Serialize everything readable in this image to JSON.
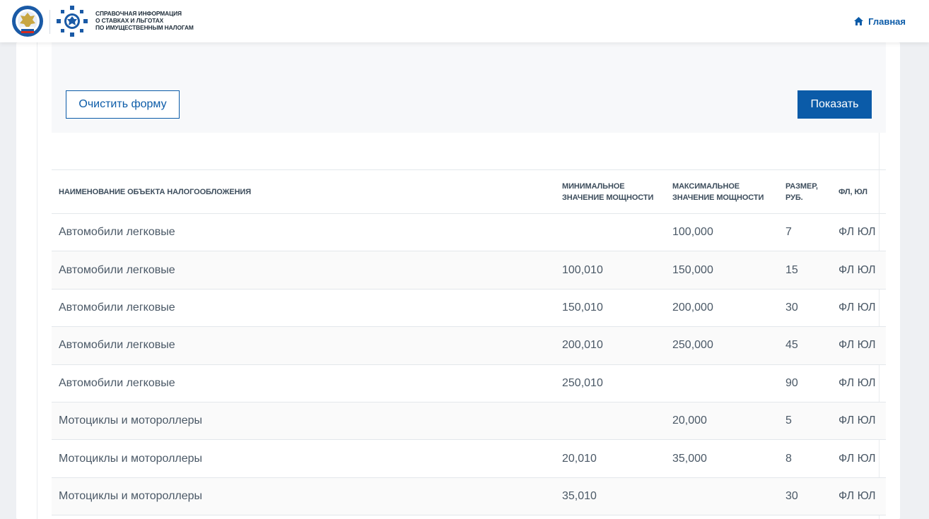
{
  "header": {
    "logo_lines": [
      "Справочная информация",
      "о ставках и льготах",
      "по имущественным налогам"
    ],
    "nav_home_label": "Главная"
  },
  "filter": {
    "clear_label": "Очистить форму",
    "show_label": "Показать"
  },
  "table": {
    "headers": {
      "object_name": "Наименование объекта налогообложения",
      "min_power_line1": "Минимальное",
      "min_power_line2": "значение мощности",
      "max_power_line1": "Максимальное",
      "max_power_line2": "значение мощности",
      "rate_line1": "Размер,",
      "rate_line2": "руб.",
      "payer": "ФЛ, ЮЛ"
    },
    "rows": [
      {
        "name": "Автомобили легковые",
        "min": "",
        "max": "100,000",
        "rate": "7",
        "payer": "ФЛ ЮЛ"
      },
      {
        "name": "Автомобили легковые",
        "min": "100,010",
        "max": "150,000",
        "rate": "15",
        "payer": "ФЛ ЮЛ"
      },
      {
        "name": "Автомобили легковые",
        "min": "150,010",
        "max": "200,000",
        "rate": "30",
        "payer": "ФЛ ЮЛ"
      },
      {
        "name": "Автомобили легковые",
        "min": "200,010",
        "max": "250,000",
        "rate": "45",
        "payer": "ФЛ ЮЛ"
      },
      {
        "name": "Автомобили легковые",
        "min": "250,010",
        "max": "",
        "rate": "90",
        "payer": "ФЛ ЮЛ"
      },
      {
        "name": "Мотоциклы и мотороллеры",
        "min": "",
        "max": "20,000",
        "rate": "5",
        "payer": "ФЛ ЮЛ"
      },
      {
        "name": "Мотоциклы и мотороллеры",
        "min": "20,010",
        "max": "35,000",
        "rate": "8",
        "payer": "ФЛ ЮЛ"
      },
      {
        "name": "Мотоциклы и мотороллеры",
        "min": "35,010",
        "max": "",
        "rate": "30",
        "payer": "ФЛ ЮЛ"
      }
    ]
  },
  "colors": {
    "accent": "#0b5ba8",
    "text": "#3d4d5c",
    "panel": "#f7f8fa"
  }
}
